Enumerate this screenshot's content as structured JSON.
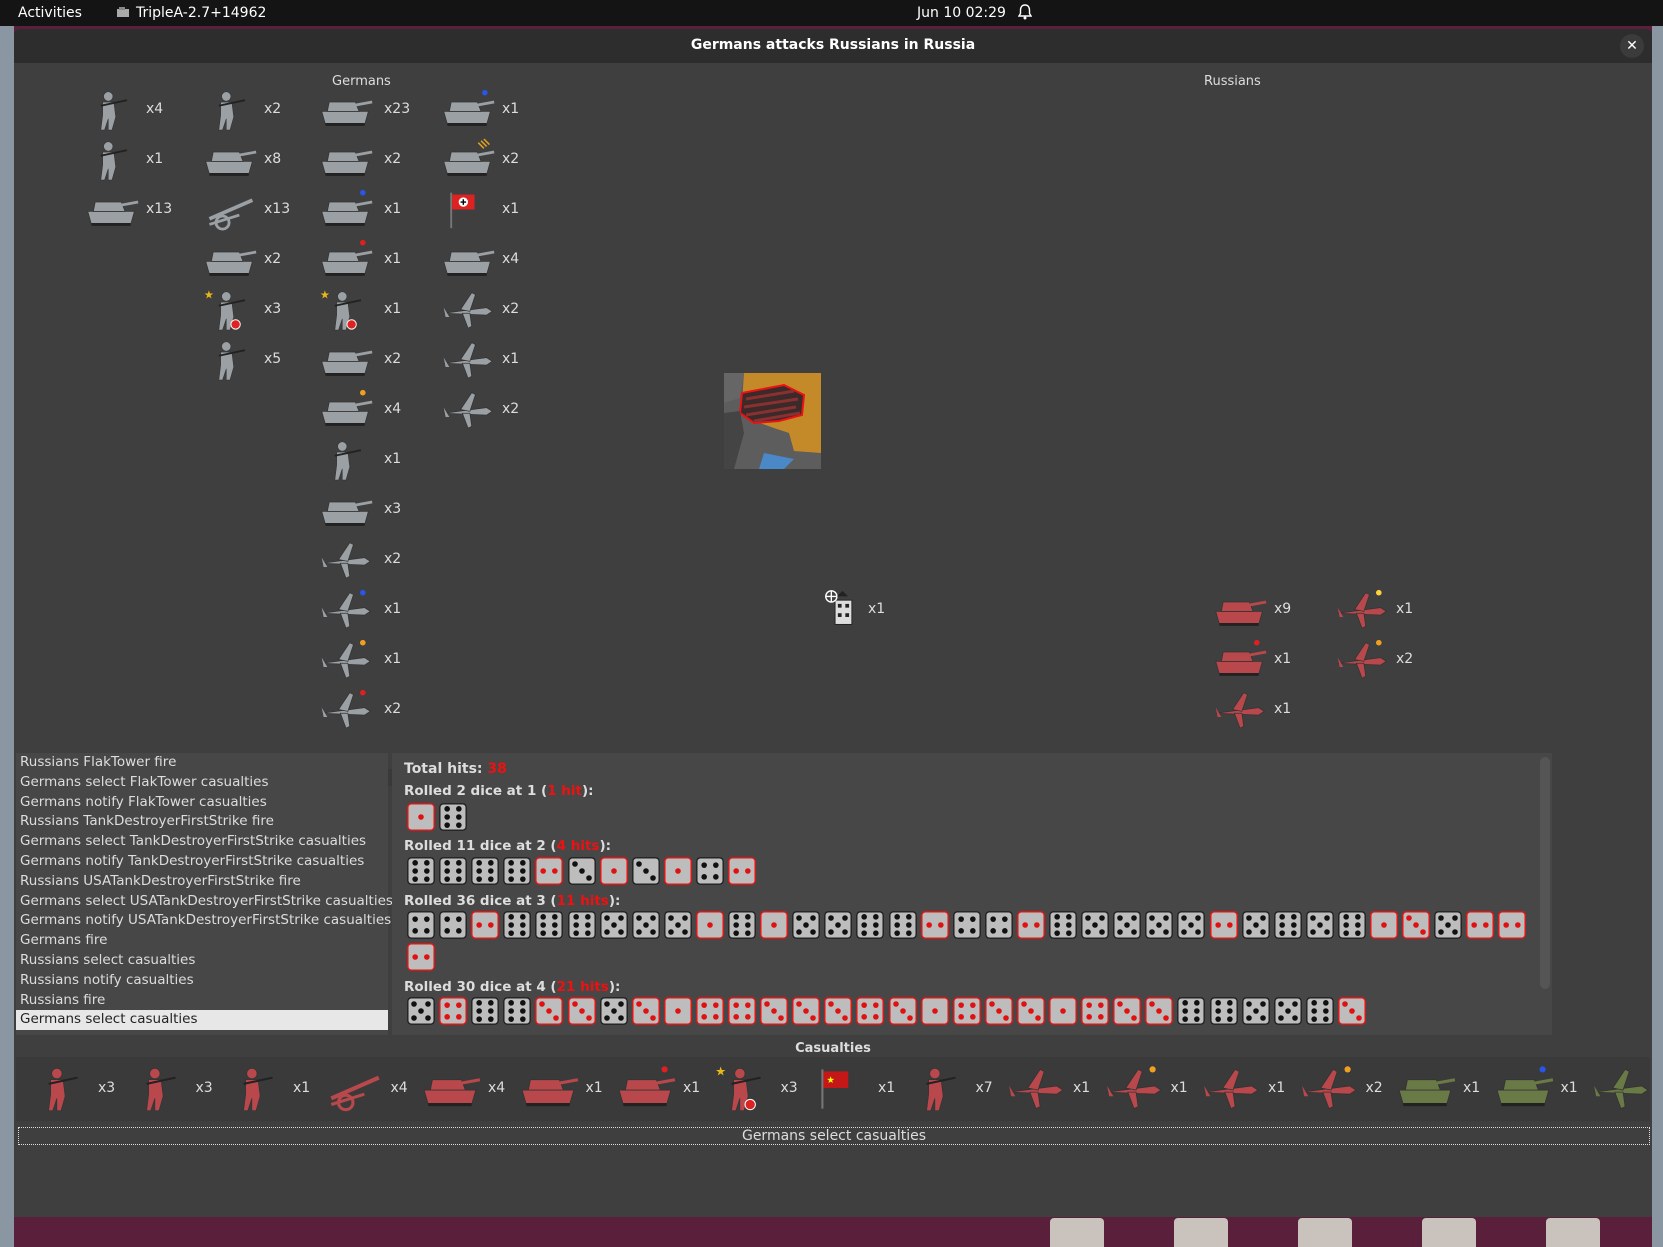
{
  "topbar": {
    "activities": "Activities",
    "app_name": "TripleA-2.7+14962",
    "clock": "Jun 10  02:29"
  },
  "window": {
    "title": "Germans attacks Russians in Russia"
  },
  "attacker": {
    "name": "Germans",
    "units": [
      {
        "icon": "infantry-icon",
        "count": "x4"
      },
      {
        "icon": "machine-gunner-icon",
        "count": "x1"
      },
      {
        "icon": "armored-car-icon",
        "count": "x13"
      },
      {
        "icon": "infantry-icon",
        "count": "x2"
      },
      {
        "icon": "halftrack-icon",
        "count": "x8"
      },
      {
        "icon": "artillery-icon",
        "count": "x13"
      },
      {
        "icon": "tank-destroyer-icon",
        "count": "x2"
      },
      {
        "icon": "elite-infantry-icon",
        "count": "x3"
      },
      {
        "icon": "paratrooper-icon",
        "count": "x5"
      },
      {
        "icon": "tank-icon",
        "count": "x23"
      },
      {
        "icon": "self-propelled-gun-icon",
        "count": "x2"
      },
      {
        "icon": "heavy-tank-blue-icon",
        "count": "x1"
      },
      {
        "icon": "heavy-tank-red-icon",
        "count": "x1"
      },
      {
        "icon": "elite-infantry-icon",
        "count": "x1"
      },
      {
        "icon": "scout-car-icon",
        "count": "x2"
      },
      {
        "icon": "tank-orange-icon",
        "count": "x4"
      },
      {
        "icon": "infantry-icon",
        "count": "x1"
      },
      {
        "icon": "truck-icon",
        "count": "x3"
      },
      {
        "icon": "fighter-icon",
        "count": "x2"
      },
      {
        "icon": "fighter-blue-icon",
        "count": "x1"
      },
      {
        "icon": "fighter-orange-icon",
        "count": "x1"
      },
      {
        "icon": "fighter-red-icon",
        "count": "x2"
      },
      {
        "icon": "panzer-blue-icon",
        "count": "x1"
      },
      {
        "icon": "panzer-veteran-icon",
        "count": "x2"
      },
      {
        "icon": "german-flag-icon",
        "count": "x1"
      },
      {
        "icon": "panzer-icon",
        "count": "x4"
      },
      {
        "icon": "dive-bomber-icon",
        "count": "x2"
      },
      {
        "icon": "bomber-icon",
        "count": "x1"
      },
      {
        "icon": "ground-attack-plane-icon",
        "count": "x2"
      }
    ]
  },
  "defender": {
    "name": "Russians",
    "units": [
      {
        "icon": "flak-tower-icon",
        "count": "x1"
      },
      {
        "icon": "soviet-tank-icon",
        "count": "x9"
      },
      {
        "icon": "soviet-tank-red-icon",
        "count": "x1"
      },
      {
        "icon": "soviet-attack-plane-icon",
        "count": "x1"
      },
      {
        "icon": "soviet-fighter-yellow-icon",
        "count": "x1"
      },
      {
        "icon": "soviet-fighter-orange-icon",
        "count": "x2"
      }
    ]
  },
  "attacker_scale": [
    "1",
    "2",
    "3",
    "4",
    "5",
    "6"
  ],
  "defender_scale": [
    "1",
    "2",
    "3",
    "4",
    "5",
    "6"
  ],
  "battle_steps": [
    "Russians FlakTower fire",
    "Germans select FlakTower casualties",
    "Germans notify FlakTower casualties",
    "Russians TankDestroyerFirstStrike fire",
    "Germans select TankDestroyerFirstStrike casualties",
    "Germans notify TankDestroyerFirstStrike casualties",
    "Russians USATankDestroyerFirstStrike fire",
    "Germans select USATankDestroyerFirstStrike casualties",
    "Germans notify USATankDestroyerFirstStrike casualties",
    "Germans fire",
    "Russians select casualties",
    "Russians notify casualties",
    "Russians fire",
    "Germans select casualties"
  ],
  "selected_step_index": 13,
  "dice": {
    "total_label": "Total hits:",
    "total_value": "38",
    "rolls": [
      {
        "prefix": "Rolled 2 dice at 1 (",
        "hits": "1 hit",
        "suffix": "):",
        "faces": [
          1,
          6
        ]
      },
      {
        "prefix": "Rolled 11 dice at 2 (",
        "hits": "4 hits",
        "suffix": "):",
        "faces": [
          6,
          6,
          6,
          6,
          2,
          3,
          1,
          3,
          1,
          4,
          2
        ]
      },
      {
        "prefix": "Rolled 36 dice at 3 (",
        "hits": "11 hits",
        "suffix": "):",
        "faces": [
          4,
          4,
          2,
          6,
          6,
          6,
          5,
          5,
          5,
          1,
          6,
          1,
          5,
          5,
          6,
          6,
          2,
          4,
          4,
          2,
          6,
          5,
          5,
          5,
          5,
          2,
          5,
          6,
          5,
          6,
          1,
          3,
          5,
          2,
          2,
          2
        ]
      },
      {
        "prefix": "Rolled 30 dice at 4 (",
        "hits": "21 hits",
        "suffix": "):",
        "faces": [
          5,
          4,
          6,
          6,
          3,
          3,
          5,
          3,
          1,
          4,
          4,
          3,
          3,
          3,
          4,
          3,
          1,
          4,
          3,
          3,
          1,
          4,
          3,
          3,
          6,
          6,
          5,
          5,
          6,
          3
        ]
      }
    ]
  },
  "casualties": {
    "label": "Casualties",
    "units": [
      {
        "icon": "soviet-guard-infantry-icon",
        "count": "x3"
      },
      {
        "icon": "soviet-infantry-icon",
        "count": "x3"
      },
      {
        "icon": "soviet-machine-gunner-icon",
        "count": "x1"
      },
      {
        "icon": "soviet-artillery-icon",
        "count": "x4"
      },
      {
        "icon": "soviet-tank-icon",
        "count": "x4"
      },
      {
        "icon": "soviet-tank-destroyer-icon",
        "count": "x1"
      },
      {
        "icon": "soviet-tank-red-icon",
        "count": "x1"
      },
      {
        "icon": "soviet-elite-infantry-icon",
        "count": "x3"
      },
      {
        "icon": "soviet-flag-icon",
        "count": "x1"
      },
      {
        "icon": "soviet-infantry-icon",
        "count": "x7"
      },
      {
        "icon": "soviet-fighter-icon",
        "count": "x1"
      },
      {
        "icon": "soviet-fighter-orange-icon",
        "count": "x1"
      },
      {
        "icon": "soviet-attack-plane-icon",
        "count": "x1"
      },
      {
        "icon": "soviet-fighter-orange-icon",
        "count": "x2"
      },
      {
        "icon": "allied-tank-icon",
        "count": "x1"
      },
      {
        "icon": "allied-tank-blue-icon",
        "count": "x1"
      },
      {
        "icon": "allied-fighter-icon",
        "count": ""
      }
    ]
  },
  "status": "Germans select  casualties",
  "colors": {
    "german_unit": "#9aa0a4",
    "russian_unit": "#b8484c",
    "hit_pip": "#e11111",
    "miss_pip": "#111111",
    "window_bg": "#3f3f3f"
  }
}
